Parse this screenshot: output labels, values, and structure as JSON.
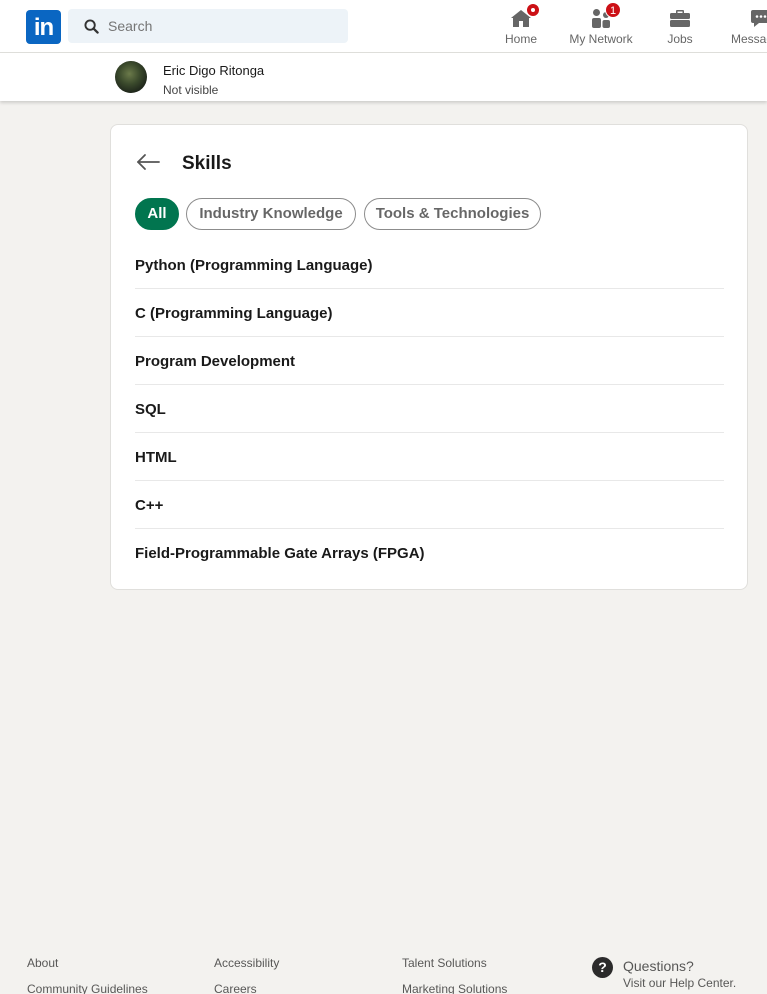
{
  "nav": {
    "logo_text": "in",
    "search_placeholder": "Search",
    "items": [
      {
        "label": "Home",
        "icon": "home-icon"
      },
      {
        "label": "My Network",
        "icon": "people-icon",
        "badge": "1"
      },
      {
        "label": "Jobs",
        "icon": "briefcase-icon"
      },
      {
        "label": "Messaging",
        "icon": "chat-icon"
      }
    ]
  },
  "profile": {
    "name": "Eric Digo Ritonga",
    "status": "Not visible"
  },
  "skills": {
    "title": "Skills",
    "filters": [
      {
        "label": "All",
        "active": true
      },
      {
        "label": "Industry Knowledge",
        "active": false
      },
      {
        "label": "Tools & Technologies",
        "active": false
      }
    ],
    "items": [
      "Python (Programming Language)",
      "C (Programming Language)",
      "Program Development",
      "SQL",
      "HTML",
      "C++",
      "Field-Programmable Gate Arrays (FPGA)"
    ]
  },
  "footer": {
    "col1": [
      "About",
      "Community Guidelines"
    ],
    "col2": [
      "Accessibility",
      "Careers"
    ],
    "col3": [
      "Talent Solutions",
      "Marketing Solutions"
    ],
    "help": {
      "title": "Questions?",
      "subtitle": "Visit our Help Center.",
      "icon_glyph": "?"
    }
  },
  "colors": {
    "brand_blue": "#0a66c2",
    "active_green": "#01754f",
    "notification_red": "#cc1016",
    "page_bg": "#f3f2ef"
  }
}
